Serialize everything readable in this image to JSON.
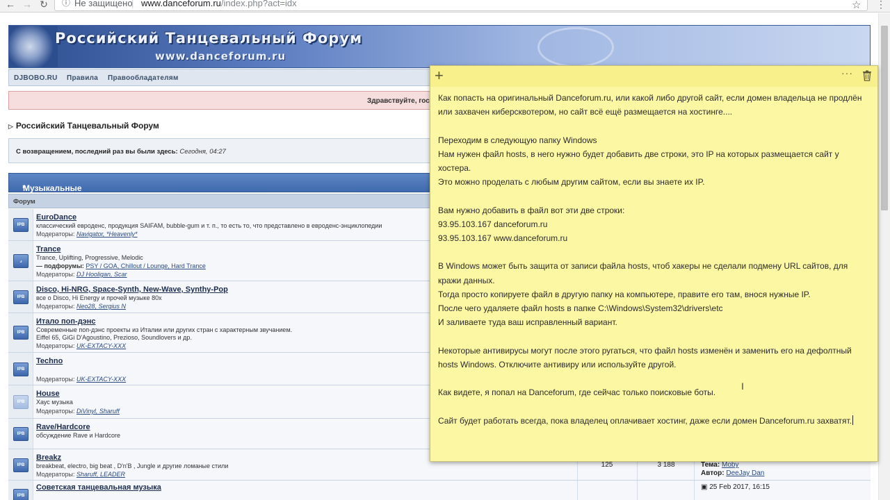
{
  "browser": {
    "nav": {
      "back_icon": "←",
      "forward_icon": "→",
      "reload_icon": "↻"
    },
    "security_label": "Не защищено",
    "url_host": "www.danceforum.ru",
    "url_path": "/index.php?act=idx"
  },
  "forum": {
    "banner_title": "Российский Танцевальный Форум",
    "banner_url": "www.danceforum.ru",
    "nav_links": [
      "DJBOBO.RU",
      "Правила",
      "Правообладателям"
    ],
    "greeting": "Здравствуйте, гос",
    "breadcrumb": "Российский Танцевальный Форум",
    "welcome_label": "С возвращением, последний раз вы были здесь:",
    "welcome_time": "Сегодня, 04:27",
    "category_title": "Музыкальные стили",
    "column_forum": "Форум",
    "forums": [
      {
        "icon": "IPB",
        "name": "EuroDance",
        "desc": "классический евроденс, продукция SAIFAM, bubble-gum и т. п., то есть то, что представлено в евроденс-энциклопедии",
        "mods_label": "Модераторы:",
        "mods": "Navigator, *Heavenly*"
      },
      {
        "icon": "",
        "name": "Trance",
        "desc": "Trance, Uplifting, Progressive, Melodic",
        "sub_label": "— подфорумы:",
        "subforums": "PSY / GOA, Chillout / Lounge, Hard Trance",
        "mods_label": "Модераторы:",
        "mods": "DJ Hooligan, Scar"
      },
      {
        "icon": "IPB",
        "name": "Disco, Hi-NRG, Space-Synth, New-Wave, Synthy-Pop",
        "desc": "все о Disco, Hi Energy и прочей музыке 80х",
        "mods_label": "Модераторы:",
        "mods": "Neo28, Sergius N"
      },
      {
        "icon": "IPB",
        "name": "Итало поп-дэнс",
        "desc": "Современные поп-дэнс проекты из Италии или других стран с характерным звучанием.",
        "desc_line2": "Eiffel 65, GiGi D'Agoustino, Prezioso, Soundlovers и др.",
        "mods_label": "Модераторы:",
        "mods": "UK-EXTACY-XXX"
      },
      {
        "icon": "IPB",
        "name": "Techno",
        "desc": "",
        "mods_label": "Модераторы:",
        "mods": "UK-EXTACY-XXX"
      },
      {
        "icon": "IPB",
        "name": "House",
        "desc": "Хаус музыка",
        "mods_label": "Модераторы:",
        "mods": "DiVinyl, Sharuff"
      },
      {
        "icon": "IPB",
        "name": "Rave/Hardcore",
        "desc": "обсуждение Rave и Hardcore",
        "mods_label": "",
        "mods": ""
      },
      {
        "icon": "IPB",
        "name": "Breakz",
        "desc": "breakbeat, electro, big beat , D'n'B , Jungle и другие ломаные стили",
        "mods_label": "Модераторы:",
        "mods": "Sharuff, LEADER",
        "topics": "125",
        "replies": "3 188",
        "last_topic_label": "Тема:",
        "last_topic": "Moby",
        "last_author_label": "Автор:",
        "last_author": "DeeJay Dan"
      },
      {
        "icon": "IPB",
        "name": "Советская танцевальная музыка",
        "desc": "",
        "mods_label": "",
        "mods": "",
        "last_date": "25 Feb 2017, 16:15"
      }
    ]
  },
  "sticky_note": {
    "add_icon": "+",
    "more_icon": "···",
    "paragraphs": [
      "Как попасть на оригинальный Danceforum.ru, или какой либо другой сайт, если домен владельца не продлён или захвачен киберсквотером, но сайт всё ещё размещается на хостинге....",
      "",
      "Переходим в следующую папку Windows",
      "Нам нужен файл hosts, в него нужно будет добавить две строки, это IP на которых размещается сайт у хостера.",
      "Это можно проделать с любым другим сайтом, если вы знаете их IP.",
      "",
      "Вам нужно добавить в файл вот эти две строки:",
      "93.95.103.167 danceforum.ru",
      "93.95.103.167 www.danceforum.ru",
      "",
      "В Windows может быть защита от записи файла hosts, чтоб хакеры не сделали подмену URL сайтов, для кражи данных.",
      "Тогда просто копируете файл в другую папку на компьютере, правите его там, внося нужные IP.",
      "После чего удаляете файл hosts в папке C:\\Windows\\System32\\drivers\\etc",
      "И заливаете туда ваш исправленный вариант.",
      "",
      "Некоторые антивирусы могут после этого ругаться, что файл hosts изменён и заменить его на дефолтный hosts Windows. Отключите антивиру или используйте другой.",
      "",
      "Как видете, я попал на Danceforum, где сейчас только поисковые боты.",
      "",
      "Сайт будет работать всегда, пока владелец оплачивает хостинг, даже если домен Danceforum.ru захватят."
    ]
  }
}
